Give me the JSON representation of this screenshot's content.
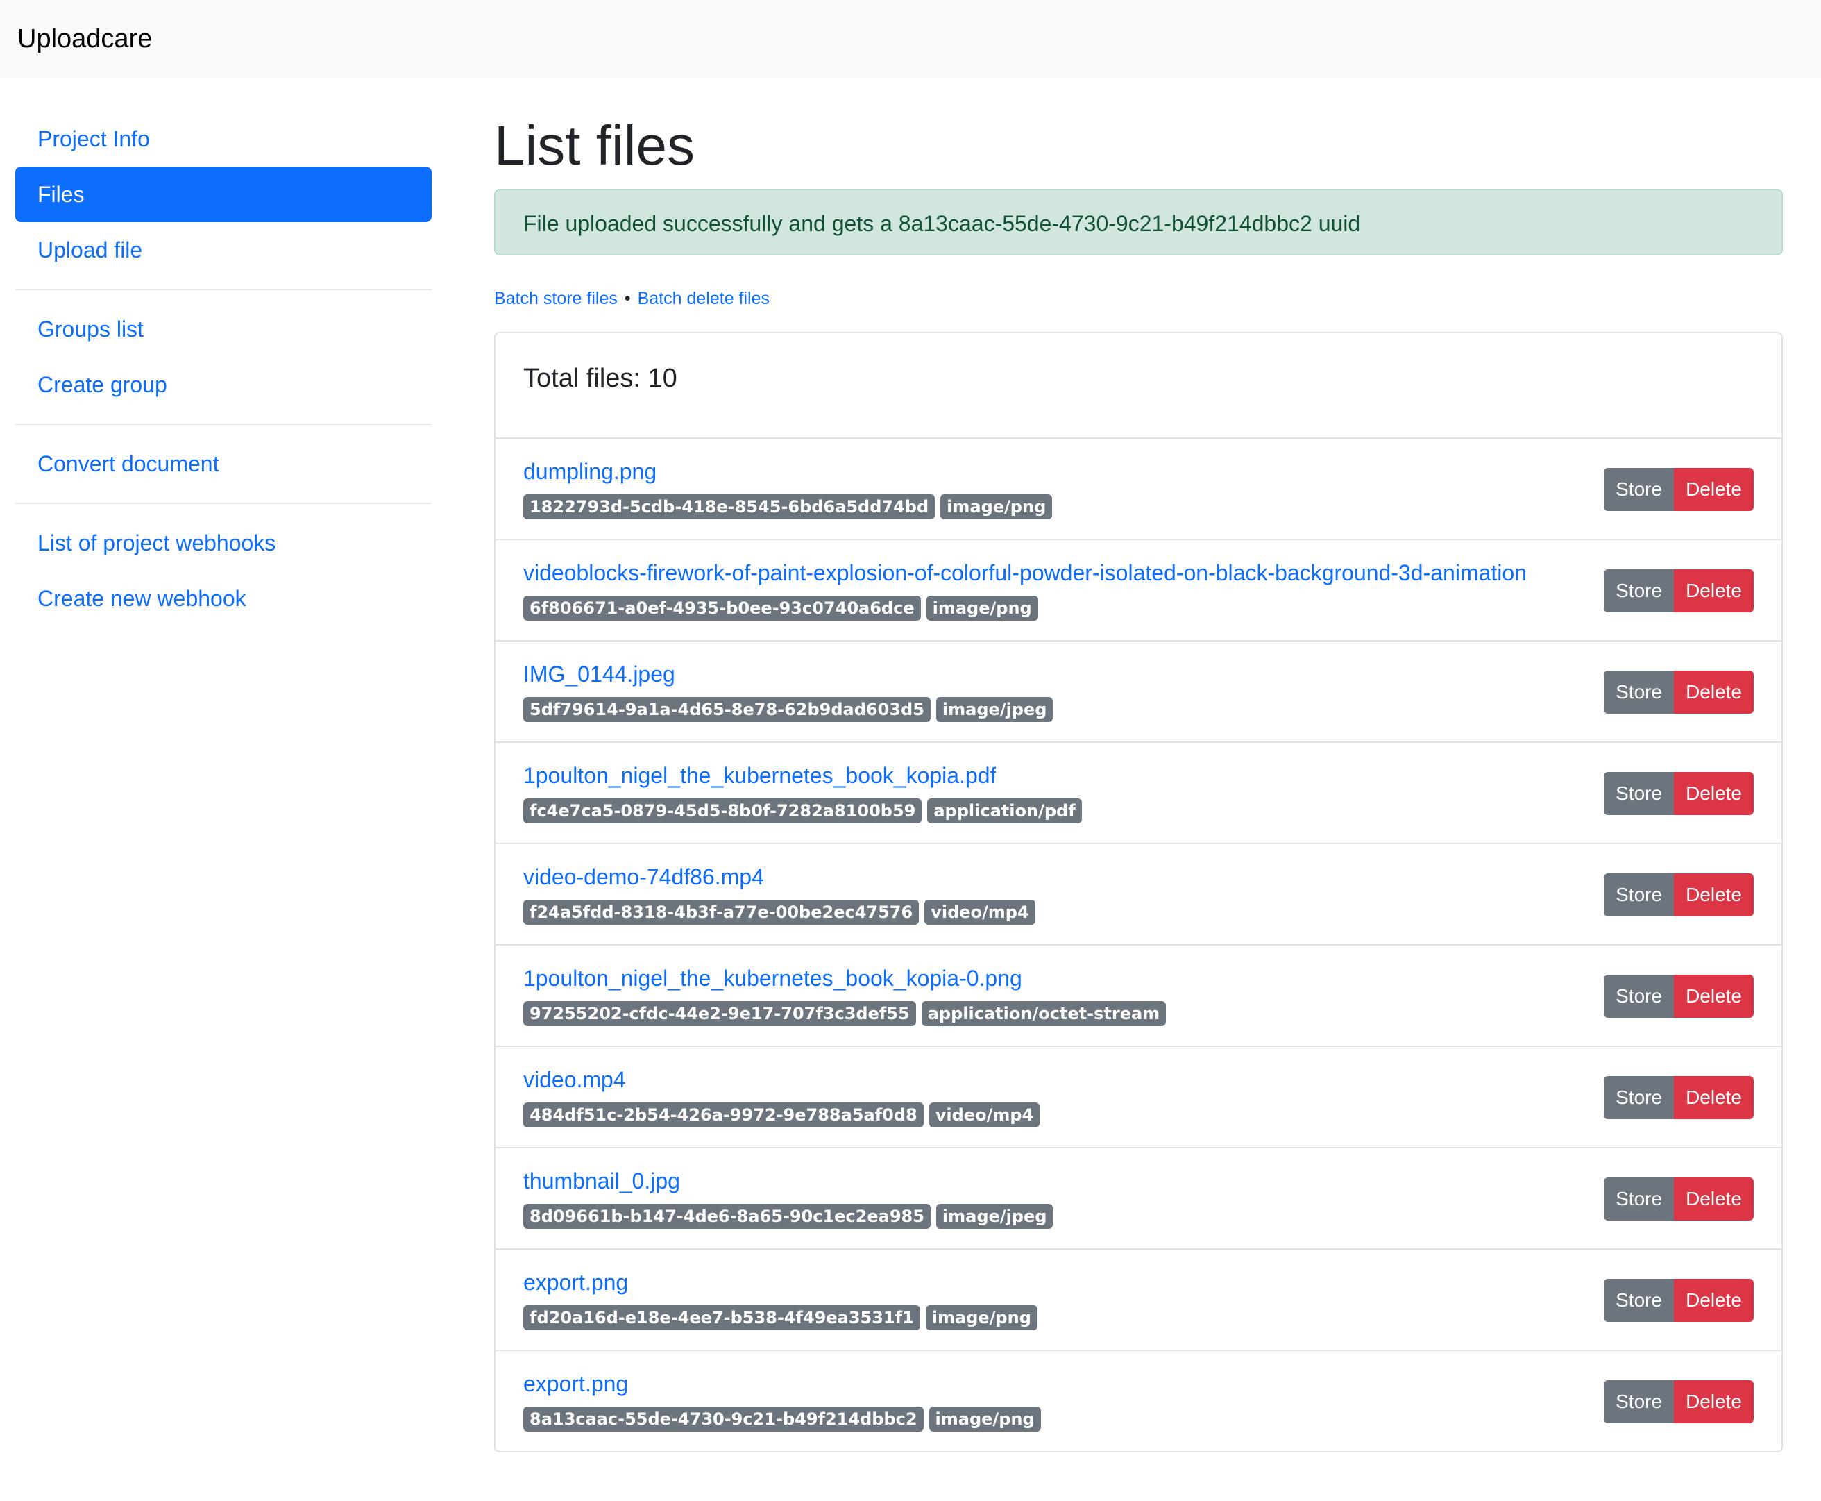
{
  "header": {
    "brand": "Uploadcare"
  },
  "sidebar": {
    "groups": [
      [
        {
          "label": "Project Info"
        },
        {
          "label": "Files",
          "active": true
        },
        {
          "label": "Upload file"
        }
      ],
      [
        {
          "label": "Groups list"
        },
        {
          "label": "Create group"
        }
      ],
      [
        {
          "label": "Convert document"
        }
      ],
      [
        {
          "label": "List of project webhooks"
        },
        {
          "label": "Create new webhook"
        }
      ]
    ]
  },
  "main": {
    "title": "List files",
    "alert": "File uploaded successfully and gets a 8a13caac-55de-4730-9c21-b49f214dbbc2 uuid",
    "batch_store": "Batch store files",
    "batch_separator": "•",
    "batch_delete": "Batch delete files",
    "total_files": "Total files: 10",
    "store_label": "Store",
    "delete_label": "Delete",
    "files": [
      {
        "name": "dumpling.png",
        "uuid": "1822793d-5cdb-418e-8545-6bd6a5dd74bd",
        "mime": "image/png"
      },
      {
        "name": "videoblocks-firework-of-paint-explosion-of-colorful-powder-isolated-on-black-background-3d-animation",
        "uuid": "6f806671-a0ef-4935-b0ee-93c0740a6dce",
        "mime": "image/png"
      },
      {
        "name": "IMG_0144.jpeg",
        "uuid": "5df79614-9a1a-4d65-8e78-62b9dad603d5",
        "mime": "image/jpeg"
      },
      {
        "name": "1poulton_nigel_the_kubernetes_book_kopia.pdf",
        "uuid": "fc4e7ca5-0879-45d5-8b0f-7282a8100b59",
        "mime": "application/pdf"
      },
      {
        "name": "video-demo-74df86.mp4",
        "uuid": "f24a5fdd-8318-4b3f-a77e-00be2ec47576",
        "mime": "video/mp4"
      },
      {
        "name": "1poulton_nigel_the_kubernetes_book_kopia-0.png",
        "uuid": "97255202-cfdc-44e2-9e17-707f3c3def55",
        "mime": "application/octet-stream"
      },
      {
        "name": "video.mp4",
        "uuid": "484df51c-2b54-426a-9972-9e788a5af0d8",
        "mime": "video/mp4"
      },
      {
        "name": "thumbnail_0.jpg",
        "uuid": "8d09661b-b147-4de6-8a65-90c1ec2ea985",
        "mime": "image/jpeg"
      },
      {
        "name": "export.png",
        "uuid": "fd20a16d-e18e-4ee7-b538-4f49ea3531f1",
        "mime": "image/png"
      },
      {
        "name": "export.png",
        "uuid": "8a13caac-55de-4730-9c21-b49f214dbbc2",
        "mime": "image/png"
      }
    ]
  }
}
